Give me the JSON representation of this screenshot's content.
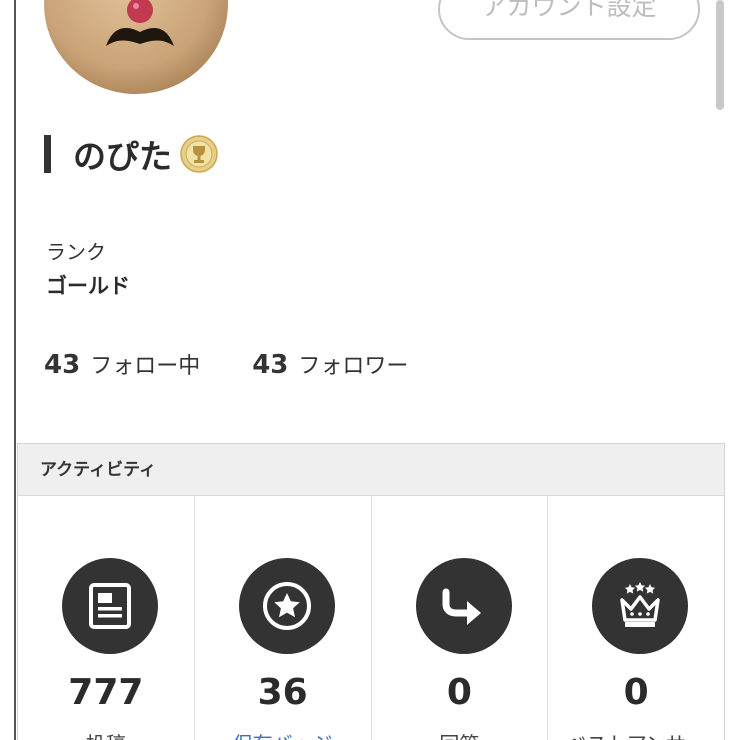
{
  "profile": {
    "account_settings_label": "アカウント設定",
    "user_name": "のぴた",
    "rank_label": "ランク",
    "rank_value": "ゴールド",
    "following_count": "43",
    "following_label": "フォロー中",
    "followers_count": "43",
    "followers_label": "フォロワー",
    "badge_icon": "gold-medal-icon"
  },
  "activity": {
    "title": "アクティビティ",
    "stats": [
      {
        "icon": "post-document-icon",
        "value": "777",
        "label": "投稿"
      },
      {
        "icon": "star-badge-icon",
        "value": "36",
        "label": "保有バッジ"
      },
      {
        "icon": "share-arrow-icon",
        "value": "0",
        "label": "回答"
      },
      {
        "icon": "crown-icon",
        "value": "0",
        "label": "ベストアンサー"
      }
    ]
  },
  "colors": {
    "icon_bg": "#333333",
    "link": "#3b6fb6",
    "header_bg": "#efefef",
    "button_border": "#c4c4c4"
  }
}
